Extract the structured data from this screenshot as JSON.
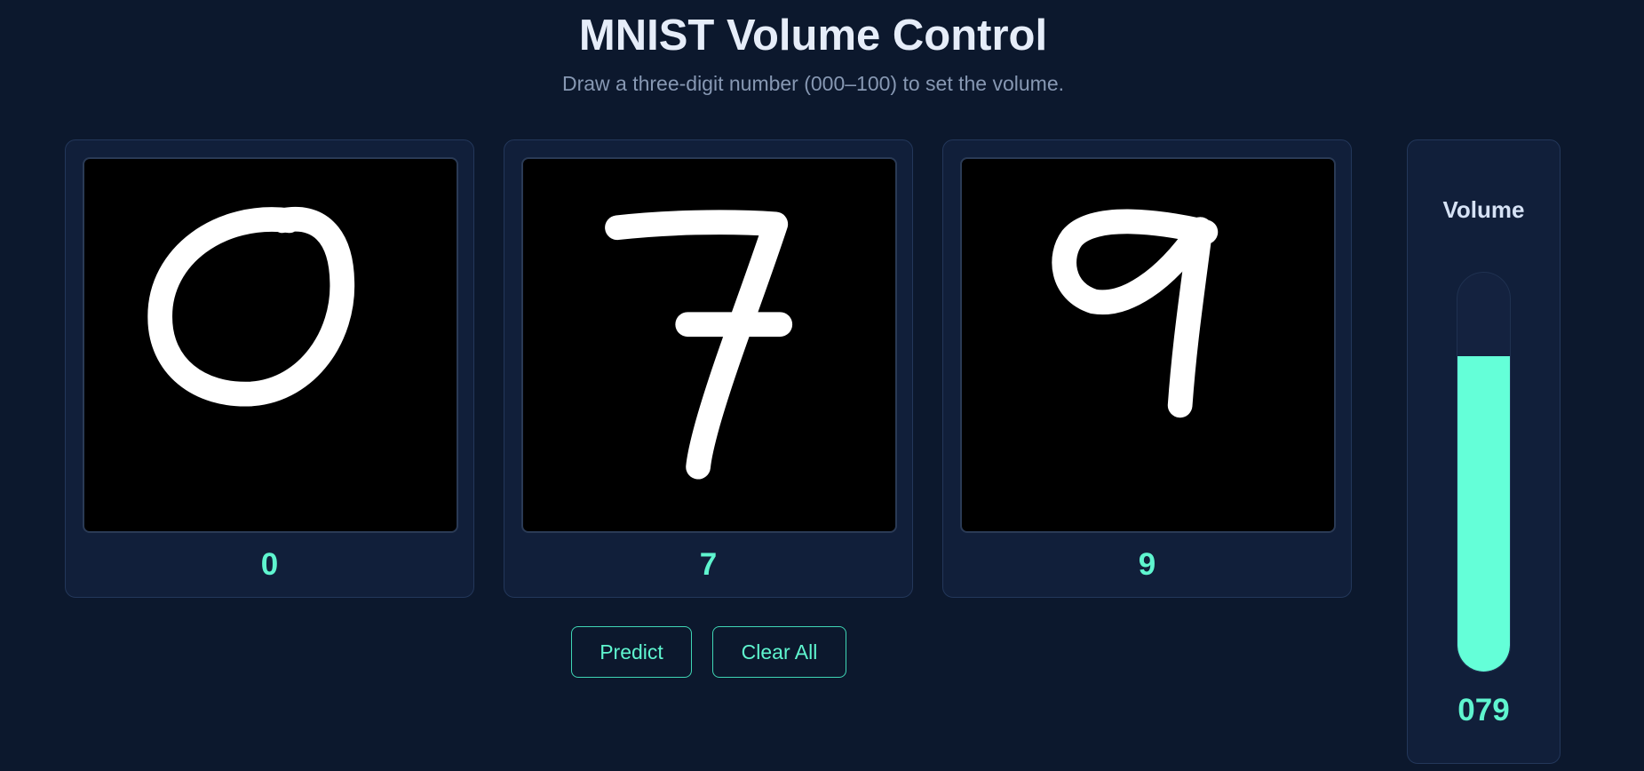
{
  "header": {
    "title": "MNIST Volume Control",
    "subtitle": "Draw a three-digit number (000–100) to set the volume."
  },
  "digits": [
    {
      "prediction": "0"
    },
    {
      "prediction": "7"
    },
    {
      "prediction": "9"
    }
  ],
  "actions": {
    "predict_label": "Predict",
    "clear_label": "Clear All"
  },
  "volume": {
    "label": "Volume",
    "display": "079",
    "level": 0.79
  },
  "colors": {
    "accent": "#64ffd8",
    "background": "#0c182d",
    "panel": "#111f3a",
    "canvas": "#000000"
  }
}
